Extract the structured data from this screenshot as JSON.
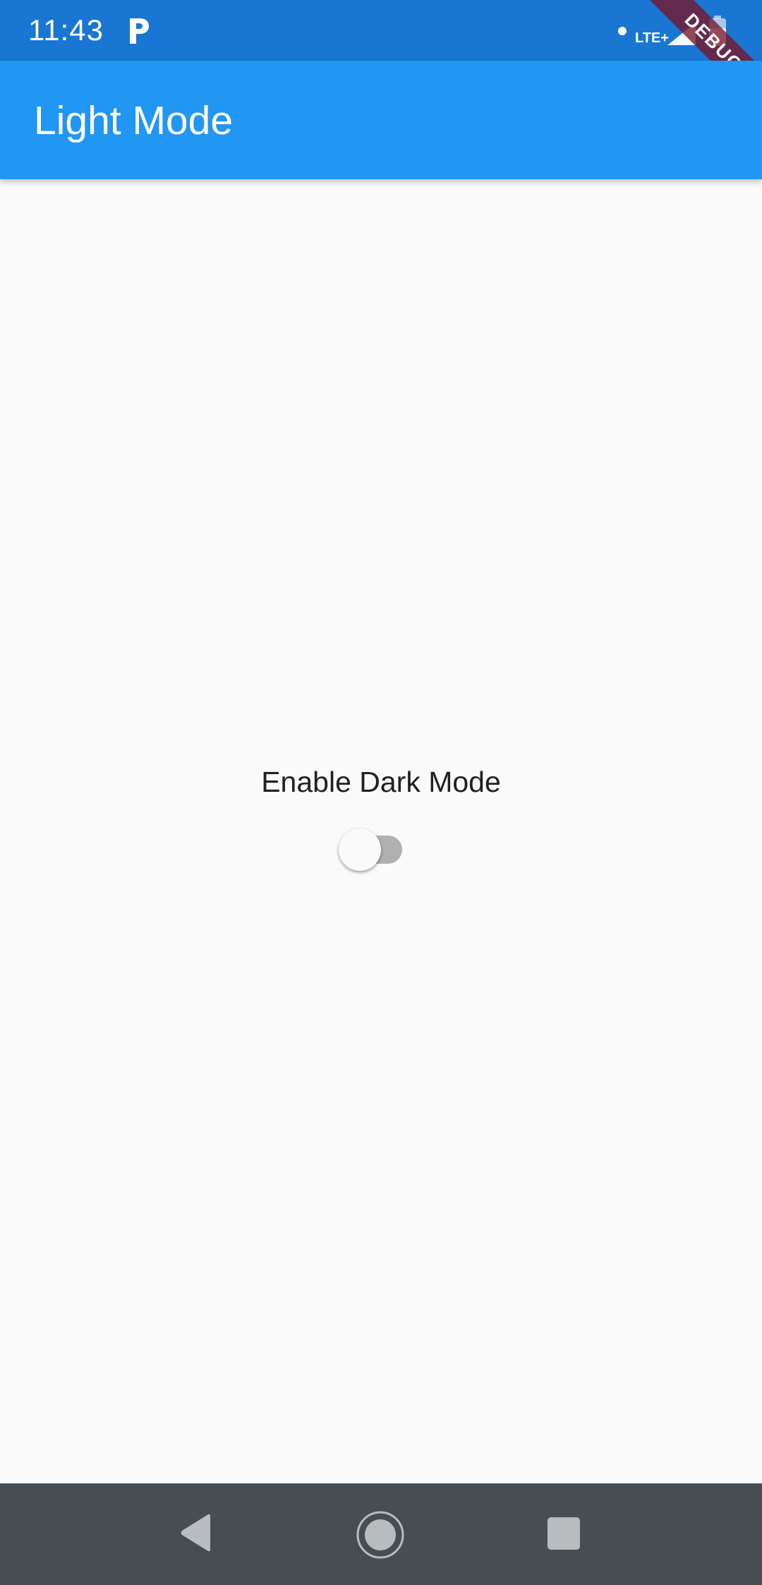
{
  "status_bar": {
    "time": "11:43",
    "network": "LTE+",
    "icons": [
      "parking-app-icon",
      "notification-dot-icon",
      "signal-icon",
      "battery-icon"
    ]
  },
  "debug_banner": {
    "label": "DEBUG"
  },
  "app_bar": {
    "title": "Light Mode",
    "color": "#2196f3"
  },
  "main": {
    "toggle_label": "Enable Dark Mode",
    "dark_mode_enabled": false
  },
  "nav_bar": {
    "icons": [
      "back-icon",
      "home-icon",
      "recents-icon"
    ]
  },
  "colors": {
    "status_bar": "#1976d2",
    "app_bar": "#2196f3",
    "background": "#fafafa",
    "nav_bar": "#464e54",
    "switch_track_off": "#b0b0b0"
  }
}
